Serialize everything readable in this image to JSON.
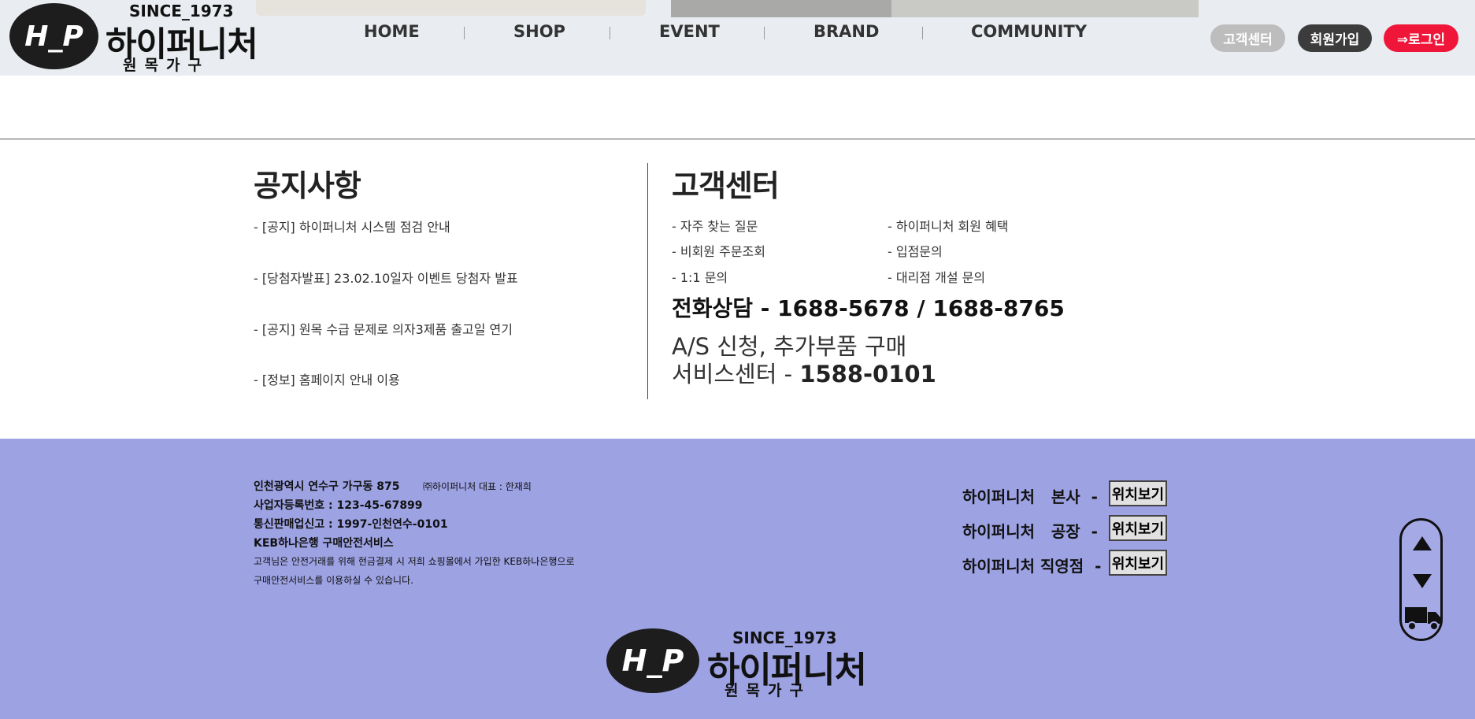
{
  "header": {
    "logo": {
      "mark": "H_P",
      "since": "SINCE_1973",
      "name": "하이퍼니처",
      "sub": "원목가구"
    },
    "nav": [
      "HOME",
      "SHOP",
      "EVENT",
      "BRAND",
      "COMMUNITY"
    ],
    "buttons": {
      "customer_center": "고객센터",
      "join": "회원가입",
      "login": "⇒로그인"
    }
  },
  "notice": {
    "title": "공지사항",
    "items": [
      "- [공지] 하이퍼니처 시스템 점검 안내",
      "- [당첨자발표] 23.02.10일자 이벤트 당첨자 발표",
      "- [공지] 원목 수급 문제로 의자3제품 출고일 연기",
      "- [정보] 홈페이지 안내 이용"
    ]
  },
  "customer_center": {
    "title": "고객센터",
    "links_left": [
      "- 자주 찾는 질문",
      "- 비회원 주문조회",
      "- 1:1 문의"
    ],
    "links_right": [
      "- 하이퍼니처 회원 혜택",
      "- 입점문의",
      "- 대리점 개설 문의"
    ],
    "phone": "전화상담 - 1688-5678 / 1688-8765",
    "as_line1": "A/S 신청, 추가부품 구매",
    "as_line2_label": "서비스센터 - ",
    "as_line2_number": "1588-0101"
  },
  "footer": {
    "address": "인천광역시 연수구 가구동 875",
    "ceo": "㈜하이퍼니처 대표 : 한재희",
    "business_number": "사업자등록번호 : 123-45-67899",
    "mail_order": "통신판매업신고 : 1997-인천연수-0101",
    "escrow_title": "KEB하나은행 구매안전서비스",
    "escrow_text1": "고객님은 안전거래를 위해 현금결제 시 저희 쇼핑몰에서 가입한 KEB하나은행으로",
    "escrow_text2": "구매안전서비스를 이용하실 수 있습니다.",
    "locations": [
      {
        "label": "하이퍼니처   본사  -",
        "button": "위치보기"
      },
      {
        "label": "하이퍼니처   공장  -",
        "button": "위치보기"
      },
      {
        "label": "하이퍼니처 직영점  -",
        "button": "위치보기"
      }
    ],
    "logo": {
      "mark": "H_P",
      "since": "SINCE_1973",
      "name": "하이퍼니처",
      "sub": "원목가구"
    }
  },
  "scroller": {
    "up_icon": "triangle-up-icon",
    "down_icon": "triangle-down-icon",
    "truck_icon": "truck-icon"
  }
}
